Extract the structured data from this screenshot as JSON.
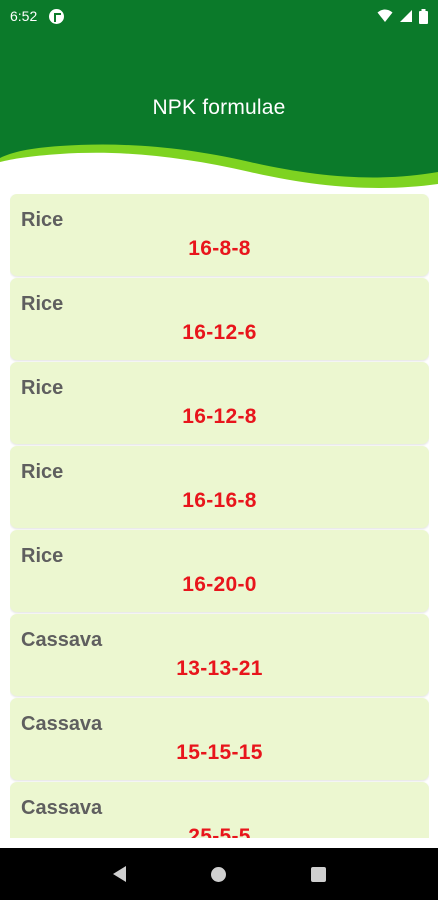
{
  "status_bar": {
    "time": "6:52",
    "icons": [
      "app-notification-icon",
      "wifi-icon",
      "signal-icon",
      "battery-icon"
    ]
  },
  "header": {
    "title": "NPK formulae",
    "colors": {
      "primary": "#0b7a2a",
      "accent": "#7ed321"
    }
  },
  "items": [
    {
      "crop": "Rice",
      "formula": "16-8-8"
    },
    {
      "crop": "Rice",
      "formula": "16-12-6"
    },
    {
      "crop": "Rice",
      "formula": "16-12-8"
    },
    {
      "crop": "Rice",
      "formula": "16-16-8"
    },
    {
      "crop": "Rice",
      "formula": "16-20-0"
    },
    {
      "crop": "Cassava",
      "formula": "13-13-21"
    },
    {
      "crop": "Cassava",
      "formula": "15-15-15"
    },
    {
      "crop": "Cassava",
      "formula": "25-5-5"
    }
  ],
  "colors": {
    "card_background": "#ecf7d0",
    "crop_text": "#5f5f5f",
    "formula_text": "#e8151c"
  },
  "nav_bar": {
    "buttons": [
      "back-icon",
      "home-icon",
      "recents-icon"
    ]
  }
}
